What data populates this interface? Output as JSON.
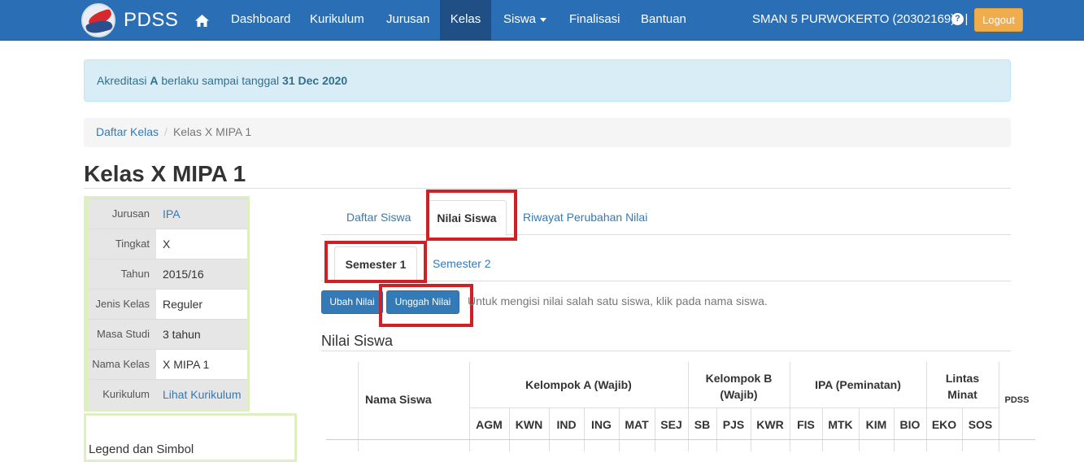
{
  "navbar": {
    "brand": "PDSS",
    "items": [
      {
        "label": "Dashboard"
      },
      {
        "label": "Kurikulum"
      },
      {
        "label": "Jurusan"
      },
      {
        "label": "Kelas"
      },
      {
        "label": "Siswa"
      },
      {
        "label": "Finalisasi"
      },
      {
        "label": "Bantuan"
      }
    ],
    "active_item": "Kelas",
    "school": "SMAN 5 PURWOKERTO (20302169)",
    "separator": "|",
    "help": "?",
    "logout": "Logout"
  },
  "alert": {
    "prefix": "Akreditasi",
    "grade": "A",
    "middle": "berlaku sampai tanggal",
    "date": "31 Dec 2020"
  },
  "breadcrumb": {
    "link": "Daftar Kelas",
    "separator": "/",
    "current": "Kelas X MIPA 1"
  },
  "page_title": "Kelas X MIPA 1",
  "info": [
    {
      "label": "Jurusan",
      "value": "IPA"
    },
    {
      "label": "Tingkat",
      "value": "X"
    },
    {
      "label": "Tahun",
      "value": "2015/16"
    },
    {
      "label": "Jenis Kelas",
      "value": "Reguler"
    },
    {
      "label": "Masa Studi",
      "value": "3 tahun"
    },
    {
      "label": "Nama Kelas",
      "value": "X MIPA 1"
    },
    {
      "label": "Kurikulum",
      "value": "Lihat Kurikulum"
    }
  ],
  "legend_title": "Legend dan Simbol",
  "tabs": [
    {
      "label": "Daftar Siswa"
    },
    {
      "label": "Nilai Siswa"
    },
    {
      "label": "Riwayat Perubahan Nilai"
    }
  ],
  "subtabs": [
    {
      "label": "Semester 1"
    },
    {
      "label": "Semester 2"
    }
  ],
  "buttons": {
    "ubah": "Ubah Nilai",
    "unggah": "Unggah Nilai"
  },
  "hint": "Untuk mengisi nilai salah satu siswa, klik pada nama siswa.",
  "section_title": "Nilai Siswa",
  "grades_table": {
    "name_header": "Nama Siswa",
    "groups": [
      {
        "label": "Kelompok A (Wajib)"
      },
      {
        "label_line1": "Kelompok B",
        "label_line2": "(Wajib)"
      },
      {
        "label": "IPA (Peminatan)"
      },
      {
        "label_line1": "Lintas",
        "label_line2": "Minat"
      }
    ],
    "pdss": "PDSS",
    "subjects": [
      "AGM",
      "KWN",
      "IND",
      "ING",
      "MAT",
      "SEJ",
      "SB",
      "PJS",
      "KWR",
      "FIS",
      "MTK",
      "KIM",
      "BIO",
      "EKO",
      "SOS"
    ]
  },
  "colors": {
    "navbar": "#2a6fb6",
    "navbar_active": "#1f4f85",
    "logout": "#f0ad4e",
    "primary": "#337ab7",
    "highlight": "#d11f26",
    "alert_bg": "#d9edf7",
    "info_border": "#dff0c0"
  },
  "icons": [
    "home-icon",
    "caret-down-icon",
    "help-icon"
  ]
}
